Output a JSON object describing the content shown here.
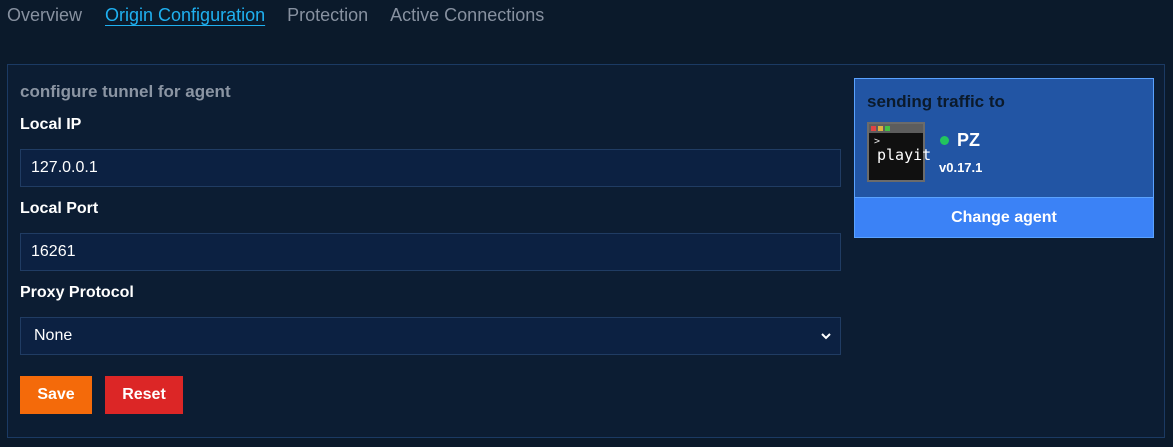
{
  "tabs": [
    {
      "label": "Overview",
      "active": false
    },
    {
      "label": "Origin Configuration",
      "active": true
    },
    {
      "label": "Protection",
      "active": false
    },
    {
      "label": "Active Connections",
      "active": false
    }
  ],
  "form": {
    "title": "configure tunnel for agent",
    "local_ip_label": "Local IP",
    "local_ip_value": "127.0.0.1",
    "local_port_label": "Local Port",
    "local_port_value": "16261",
    "proxy_protocol_label": "Proxy Protocol",
    "proxy_protocol_value": "None",
    "save_label": "Save",
    "reset_label": "Reset"
  },
  "agent": {
    "card_title": "sending traffic to",
    "logo_text": "playit",
    "name": "PZ",
    "version": "v0.17.1",
    "status": "online",
    "change_label": "Change agent"
  },
  "colors": {
    "accent": "#1fb0f0",
    "save": "#f46a0a",
    "reset": "#dc2626",
    "agent_card": "#2255a4",
    "change_button": "#3b82f6",
    "status_online": "#22c55e"
  }
}
